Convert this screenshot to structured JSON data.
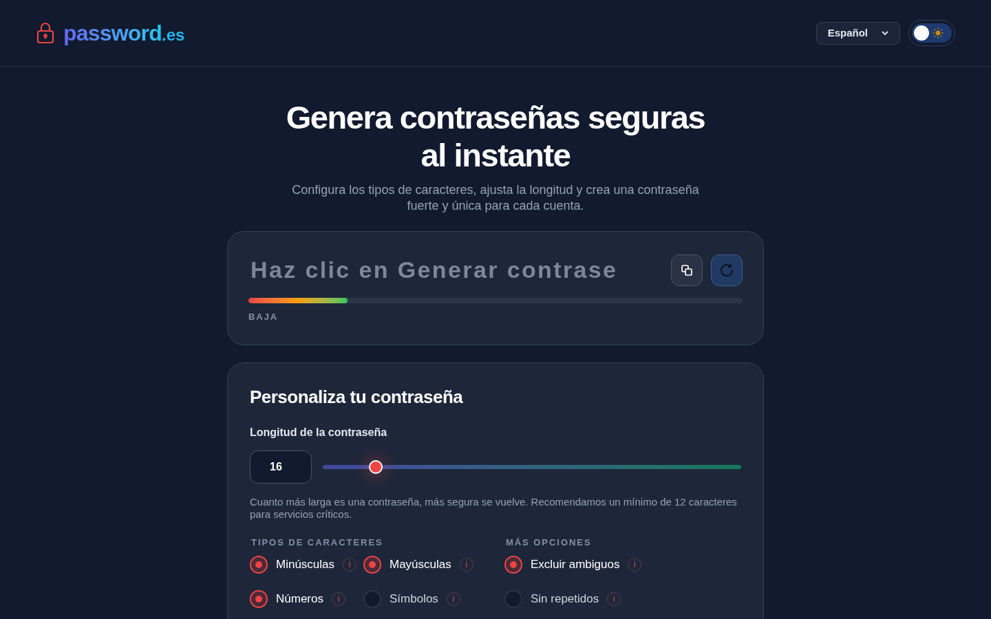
{
  "header": {
    "logo": {
      "name": "password",
      "tld": ".es"
    },
    "language": "Español",
    "theme_toggle": {
      "on": false
    }
  },
  "hero": {
    "title_lines": [
      "Genera contraseñas seguras",
      "al instante"
    ],
    "subtitle": "Configura los tipos de caracteres, ajusta la longitud y crea una contraseña fuerte y única para cada cuenta."
  },
  "generator": {
    "placeholder": "Haz clic en Generar contrase",
    "strength": {
      "level": 0.2,
      "label": "BAJA"
    }
  },
  "settings": {
    "title": "Personaliza tu contraseña",
    "length": {
      "label": "Longitud de la contraseña",
      "value": "16",
      "level": 0.127,
      "hint": "Cuanto más larga es una contraseña, más segura se vuelve. Recomendamos un mínimo de 12 caracteres para servicios críticos."
    },
    "groups": [
      {
        "heading": "TIPOS DE CARACTERES",
        "options": [
          {
            "label": "Minúsculas",
            "checked": true,
            "info": "i"
          },
          {
            "label": "Mayúsculas",
            "checked": true,
            "info": "i"
          },
          {
            "label": "Números",
            "checked": true,
            "info": "i"
          },
          {
            "label": "Símbolos",
            "checked": false,
            "info": "i"
          }
        ]
      },
      {
        "heading": "MÁS OPCIONES",
        "options": [
          {
            "label": "Excluir ambiguos",
            "checked": true,
            "info": "i"
          },
          {
            "label": "Sin repetidos",
            "checked": false,
            "info": "i"
          }
        ]
      }
    ]
  }
}
